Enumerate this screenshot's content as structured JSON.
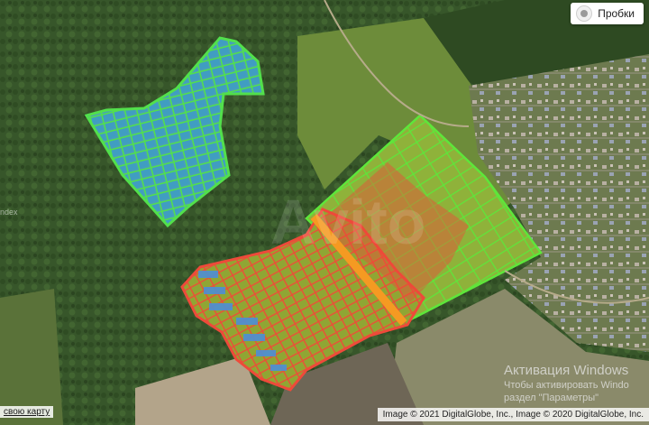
{
  "controls": {
    "traffic_label": "Пробки",
    "edit_map_link": "свою карту"
  },
  "attribution": {
    "copyright": "Image © 2021 DigitalGlobe, Inc., Image © 2020 DigitalGlobe, Inc."
  },
  "overlay": {
    "activation_title": "Активация Windows",
    "activation_line1": "Чтобы активировать Windo",
    "activation_line2": "раздел \"Параметры\""
  },
  "side_text": "ndex",
  "plots": {
    "north_block_color": "#52e04c",
    "east_block_color": "#5ee63a",
    "south_block_color": "#ee4a3a",
    "road_color": "#f59a22",
    "vacant_lot_color": "#4d8fd6"
  }
}
